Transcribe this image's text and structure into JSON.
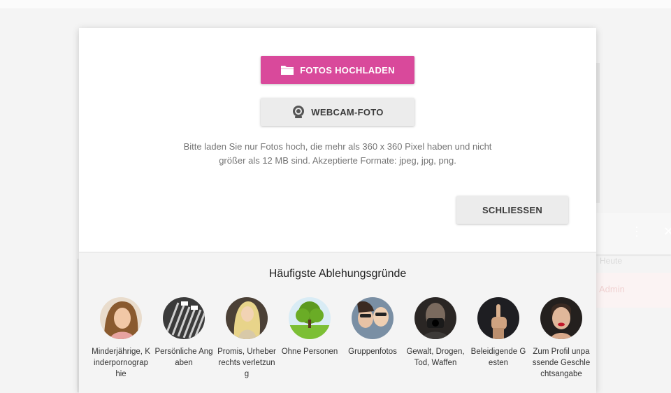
{
  "dialog": {
    "upload_label": "FOTOS HOCHLADEN",
    "webcam_label": "WEBCAM-FOTO",
    "hint_line1": "Bitte laden Sie nur Fotos hoch, die mehr als 360 x 360 Pixel haben und nicht",
    "hint_line2": "größer als 12 MB sind. Akzeptierte Formate: jpeg, jpg, png.",
    "close_label": "SCHLIESSEN"
  },
  "reasons": {
    "title": "Häufigste Ablehungsgründe",
    "items": [
      {
        "label": "Minderjährige, Kinderpornographie"
      },
      {
        "label": "Persönliche Angaben"
      },
      {
        "label": "Promis, Urheberrechts verletzung"
      },
      {
        "label": "Ohne Personen"
      },
      {
        "label": "Gruppenfotos"
      },
      {
        "label": "Gewalt, Drogen, Tod, Waffen"
      },
      {
        "label": "Beleidigende Gesten"
      },
      {
        "label": "Zum Profil unpassende Geschlechtsangabe"
      }
    ]
  },
  "background": {
    "right_text1": "Heute",
    "right_text2": "Admin"
  },
  "colors": {
    "accent": "#d9499b",
    "secondary_button": "#ececec"
  }
}
